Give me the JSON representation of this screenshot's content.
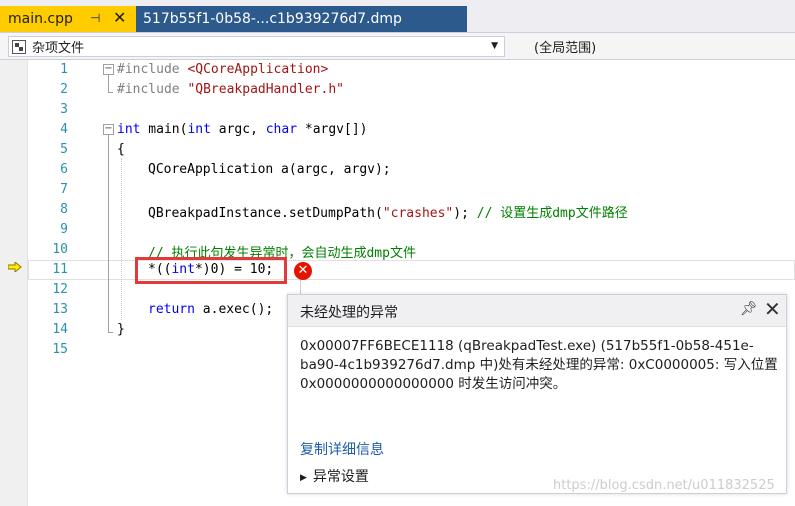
{
  "tabs": {
    "active": {
      "title": "main.cpp",
      "pin_icon": "pin-icon",
      "close_icon": "close-icon"
    },
    "inactive": {
      "title": "517b55f1-0b58-...c1b939276d7.dmp"
    }
  },
  "navbar": {
    "scope_left": "杂项文件",
    "scope_right": "(全局范围)"
  },
  "code": {
    "line_numbers": [
      "1",
      "2",
      "3",
      "4",
      "5",
      "6",
      "7",
      "8",
      "9",
      "10",
      "11",
      "12",
      "13",
      "14",
      "15"
    ],
    "l1_pp": "#include ",
    "l1_str": "<QCoreApplication>",
    "l2_pp": "#include ",
    "l2_str": "\"QBreakpadHandler.h\"",
    "l4_kw1": "int",
    "l4_t1": " main(",
    "l4_kw2": "int",
    "l4_t2": " argc, ",
    "l4_kw3": "char",
    "l4_t3": " *argv[])",
    "l5": "{",
    "l6": "QCoreApplication a(argc, argv);",
    "l8_t1": "QBreakpadInstance.setDumpPath(",
    "l8_str": "\"crashes\"",
    "l8_t2": "); ",
    "l8_cm": "// 设置生成dmp文件路径",
    "l10_cm": "// 执行此句发生异常时，会自动生成dmp文件",
    "l11_t1": "*((",
    "l11_kw": "int",
    "l11_t2": "*)0) = 10;",
    "l13_kw": "return",
    "l13_t": " a.exec();",
    "l14": "}"
  },
  "exception": {
    "title": "未经处理的异常",
    "message": "0x00007FF6BECE1118 (qBreakpadTest.exe) (517b55f1-0b58-451e-ba90-4c1b939276d7.dmp 中)处有未经处理的异常: 0xC0000005: 写入位置 0x0000000000000000 时发生访问冲突。",
    "copy_link": "复制详细信息",
    "settings": "异常设置"
  },
  "watermark": "https://blog.csdn.net/u011832525",
  "colors": {
    "tab_active": "#ffcc00",
    "tab_inactive": "#2d5a8c",
    "error": "#e51400",
    "link": "#1e5ca8"
  }
}
